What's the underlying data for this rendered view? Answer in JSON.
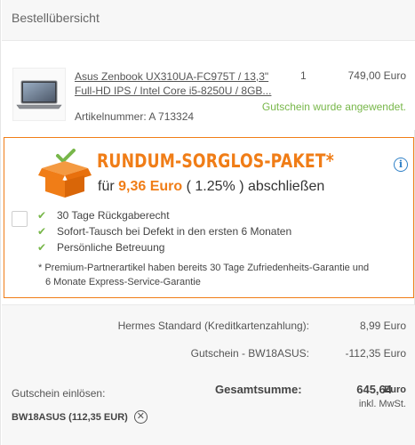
{
  "header": {
    "title": "Bestellübersicht"
  },
  "product": {
    "name_line1": "Asus Zenbook UX310UA-FC975T / 13,3\"",
    "name_line2": "Full-HD IPS / Intel Core i5-8250U / 8GB...",
    "quantity": "1",
    "price": "749,00 Euro",
    "voucher_note": "Gutschein wurde angewendet.",
    "article_number": "Artikelnummer: A 713324",
    "thumbnail_icon": "laptop-image"
  },
  "bundle": {
    "title": "RUNDUM-SORGLOS-PAKET*",
    "price_prefix": "für",
    "price_amount": "9,36 Euro",
    "price_percent": "( 1.25% )",
    "price_suffix": "abschließen",
    "features": [
      "30 Tage Rückgaberecht",
      "Sofort-Tausch bei Defekt in den ersten 6 Monaten",
      "Persönliche Betreuung"
    ],
    "footnote_line1": "* Premium-Partnerartikel haben bereits 30 Tage Zufriedenheits-Garantie und",
    "footnote_line2": "6 Monate Express-Service-Garantie",
    "check_glyph": "✔",
    "info_glyph": "i",
    "accent_color": "#f07d17",
    "check_color": "#78b74a"
  },
  "summary": {
    "shipping_label": "Hermes Standard (Kreditkartenzahlung):",
    "shipping_value": "8,99 Euro",
    "discount_label": "Gutschein - BW18ASUS:",
    "discount_value": "-112,35 Euro",
    "redeem_label": "Gutschein einlösen:",
    "total_label": "Gesamtsumme:",
    "total_value": "645,64",
    "total_currency": "Euro",
    "vat_note": "inkl. MwSt.",
    "applied_code": "BW18ASUS (112,35 EUR)",
    "remove_glyph": "✕"
  }
}
